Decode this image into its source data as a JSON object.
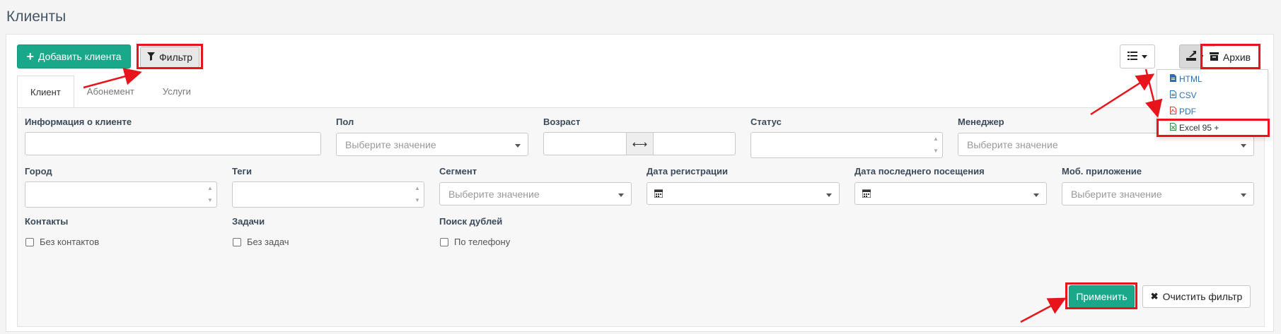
{
  "page": {
    "title": "Клиенты"
  },
  "toolbar": {
    "add_client": "Добавить клиента",
    "filter": "Фильтр",
    "archive": "Архив"
  },
  "export_menu": {
    "items": [
      "HTML",
      "CSV",
      "PDF",
      "Excel 95 +"
    ]
  },
  "tabs": [
    "Клиент",
    "Абонемент",
    "Услуги"
  ],
  "filters": {
    "client_info": {
      "label": "Информация о клиенте",
      "value": ""
    },
    "gender": {
      "label": "Пол",
      "placeholder": "Выберите значение"
    },
    "age": {
      "label": "Возраст",
      "from": "",
      "to": ""
    },
    "status": {
      "label": "Статус",
      "value": ""
    },
    "manager": {
      "label": "Менеджер",
      "placeholder": "Выберите значение"
    },
    "city": {
      "label": "Город",
      "value": ""
    },
    "tags": {
      "label": "Теги",
      "value": ""
    },
    "segment": {
      "label": "Сегмент",
      "placeholder": "Выберите значение"
    },
    "reg_date": {
      "label": "Дата регистрации",
      "value": ""
    },
    "last_visit": {
      "label": "Дата последнего посещения",
      "value": ""
    },
    "mobile_app": {
      "label": "Моб. приложение",
      "placeholder": "Выберите значение"
    },
    "contacts": {
      "label": "Контакты",
      "checkbox": "Без контактов"
    },
    "tasks": {
      "label": "Задачи",
      "checkbox": "Без задач"
    },
    "dupes": {
      "label": "Поиск дублей",
      "checkbox": "По телефону"
    }
  },
  "actions": {
    "apply": "Применить",
    "clear": "Очистить фильтр"
  },
  "colors": {
    "accent_green": "#1aa88a",
    "highlight_red": "#e8141b",
    "link_blue": "#2f6fae"
  }
}
